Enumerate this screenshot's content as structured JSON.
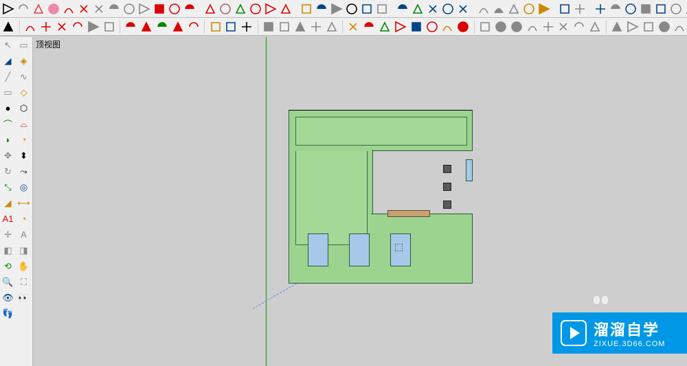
{
  "viewport_label": "顶视图",
  "watermark": {
    "title": "溜溜自学",
    "url": "ZIXUE.3D66.COM"
  },
  "toolbar_row1": [
    {
      "name": "select-arrow",
      "color": "#000"
    },
    {
      "name": "component-make",
      "color": "#888"
    },
    {
      "name": "paint-bucket",
      "color": "#d44"
    },
    {
      "name": "eraser",
      "color": "#e8a"
    },
    {
      "name": "pencil",
      "color": "#d00"
    },
    {
      "name": "freehand",
      "color": "#d00"
    },
    {
      "name": "rectangle",
      "color": "#888"
    },
    {
      "name": "rotated-rect",
      "color": "#888"
    },
    {
      "name": "circle",
      "color": "#888"
    },
    {
      "name": "polygon",
      "color": "#888"
    },
    {
      "name": "arc-2pt",
      "color": "#d00"
    },
    {
      "name": "arc-3pt",
      "color": "#d00"
    },
    {
      "name": "pie",
      "color": "#d00"
    },
    {
      "name": "sep"
    },
    {
      "name": "move",
      "color": "#d00"
    },
    {
      "name": "push-pull",
      "color": "#a66"
    },
    {
      "name": "rotate",
      "color": "#080"
    },
    {
      "name": "follow-me",
      "color": "#d00"
    },
    {
      "name": "scale",
      "color": "#d00"
    },
    {
      "name": "offset",
      "color": "#d00"
    },
    {
      "name": "sep"
    },
    {
      "name": "tape-measure",
      "color": "#c80"
    },
    {
      "name": "dimension",
      "color": "#048"
    },
    {
      "name": "protractor",
      "color": "#888"
    },
    {
      "name": "text-label",
      "color": "#000"
    },
    {
      "name": "axes",
      "color": "#048"
    },
    {
      "name": "3d-text",
      "color": "#888"
    },
    {
      "name": "sep"
    },
    {
      "name": "orbit-icon",
      "color": "#048"
    },
    {
      "name": "pan",
      "color": "#080"
    },
    {
      "name": "zoom",
      "color": "#048"
    },
    {
      "name": "zoom-window",
      "color": "#048"
    },
    {
      "name": "zoom-extents",
      "color": "#048"
    },
    {
      "name": "sep"
    },
    {
      "name": "position-camera",
      "color": "#888"
    },
    {
      "name": "look-around",
      "color": "#888"
    },
    {
      "name": "walk",
      "color": "#888"
    },
    {
      "name": "section-plane",
      "color": "#c80"
    },
    {
      "name": "section-display",
      "color": "#c80"
    },
    {
      "name": "sep"
    },
    {
      "name": "shadows",
      "color": "#048"
    },
    {
      "name": "fog",
      "color": "#888"
    },
    {
      "name": "sep"
    },
    {
      "name": "xray",
      "color": "#048"
    },
    {
      "name": "back-edges",
      "color": "#888"
    },
    {
      "name": "wireframe",
      "color": "#048"
    },
    {
      "name": "hidden-line",
      "color": "#888"
    },
    {
      "name": "shaded",
      "color": "#048"
    },
    {
      "name": "shaded-textures",
      "color": "#888"
    },
    {
      "name": "monochrome",
      "color": "#080"
    },
    {
      "name": "sep"
    },
    {
      "name": "model-info",
      "color": "#d00"
    },
    {
      "name": "entity-info",
      "color": "#080"
    },
    {
      "name": "materials",
      "color": "#048"
    },
    {
      "name": "components",
      "color": "#c80"
    },
    {
      "name": "styles",
      "color": "#888"
    },
    {
      "name": "layers",
      "color": "#048"
    },
    {
      "name": "outliner",
      "color": "#d00"
    },
    {
      "name": "scenes",
      "color": "#080"
    }
  ],
  "toolbar_row2": [
    {
      "name": "select-arrow-2",
      "color": "#000"
    },
    {
      "name": "sep"
    },
    {
      "name": "curve-1",
      "color": "#d00"
    },
    {
      "name": "curve-2",
      "color": "#d00"
    },
    {
      "name": "curve-3",
      "color": "#d00"
    },
    {
      "name": "curve-4",
      "color": "#d00"
    },
    {
      "name": "face-tool-1",
      "color": "#888"
    },
    {
      "name": "face-tool-2",
      "color": "#888"
    },
    {
      "name": "sep"
    },
    {
      "name": "move-2",
      "color": "#d00"
    },
    {
      "name": "push-2",
      "color": "#d00"
    },
    {
      "name": "rotate-2",
      "color": "#080"
    },
    {
      "name": "scale-2",
      "color": "#d00"
    },
    {
      "name": "offset-2",
      "color": "#d00"
    },
    {
      "name": "sep"
    },
    {
      "name": "tape-2",
      "color": "#c80"
    },
    {
      "name": "dim-2",
      "color": "#048"
    },
    {
      "name": "text-2",
      "color": "#000"
    },
    {
      "name": "sep"
    },
    {
      "name": "cam-iso",
      "color": "#888"
    },
    {
      "name": "cam-top",
      "color": "#888"
    },
    {
      "name": "cam-front",
      "color": "#888"
    },
    {
      "name": "cam-right",
      "color": "#888"
    },
    {
      "name": "cam-back",
      "color": "#888"
    },
    {
      "name": "sep"
    },
    {
      "name": "plugin-1",
      "color": "#c80"
    },
    {
      "name": "plugin-2",
      "color": "#d00"
    },
    {
      "name": "plugin-3",
      "color": "#080"
    },
    {
      "name": "plugin-4",
      "color": "#d00"
    },
    {
      "name": "plugin-5",
      "color": "#048"
    },
    {
      "name": "plugin-6",
      "color": "#d00"
    },
    {
      "name": "plugin-7",
      "color": "#c80"
    },
    {
      "name": "ruby",
      "color": "#d00"
    },
    {
      "name": "sep"
    },
    {
      "name": "warehouse-1",
      "color": "#888"
    },
    {
      "name": "warehouse-2",
      "color": "#888"
    },
    {
      "name": "house-1",
      "color": "#888"
    },
    {
      "name": "house-2",
      "color": "#888"
    },
    {
      "name": "house-3",
      "color": "#888"
    },
    {
      "name": "house-4",
      "color": "#888"
    },
    {
      "name": "house-5",
      "color": "#888"
    },
    {
      "name": "house-6",
      "color": "#888"
    },
    {
      "name": "sep"
    },
    {
      "name": "box-1",
      "color": "#888"
    },
    {
      "name": "box-2",
      "color": "#888"
    },
    {
      "name": "box-3",
      "color": "#888"
    },
    {
      "name": "box-4",
      "color": "#888"
    },
    {
      "name": "box-5",
      "color": "#888"
    }
  ],
  "toolbar_left": [
    {
      "name": "select",
      "glyph": "↖"
    },
    {
      "name": "make-component",
      "glyph": "▭"
    },
    {
      "name": "paint-bucket-l",
      "glyph": "◢"
    },
    {
      "name": "eraser-l",
      "glyph": "◈"
    },
    {
      "name": "line",
      "glyph": "╱"
    },
    {
      "name": "freehand-l",
      "glyph": "∿"
    },
    {
      "name": "rectangle-l",
      "glyph": "▭"
    },
    {
      "name": "rotated-rect-l",
      "glyph": "◇"
    },
    {
      "name": "circle-l",
      "glyph": "●"
    },
    {
      "name": "polygon-l",
      "glyph": "⬡"
    },
    {
      "name": "arc-l",
      "glyph": "⌒"
    },
    {
      "name": "arc-2pt-l",
      "glyph": "⌓"
    },
    {
      "name": "arc-3pt-l",
      "glyph": "◗"
    },
    {
      "name": "pie-l",
      "glyph": "◔"
    },
    {
      "name": "move-l",
      "glyph": "✥"
    },
    {
      "name": "push-pull-l",
      "glyph": "⬍"
    },
    {
      "name": "rotate-l",
      "glyph": "↻"
    },
    {
      "name": "follow-me-l",
      "glyph": "⤳"
    },
    {
      "name": "scale-l",
      "glyph": "⤡"
    },
    {
      "name": "offset-l",
      "glyph": "◎"
    },
    {
      "name": "tape-l",
      "glyph": "◢"
    },
    {
      "name": "dimension-l",
      "glyph": "⟷"
    },
    {
      "name": "text-l",
      "glyph": "A1"
    },
    {
      "name": "protractor-l",
      "glyph": "◔"
    },
    {
      "name": "axes-l",
      "glyph": "✛"
    },
    {
      "name": "3d-text-l",
      "glyph": "A"
    },
    {
      "name": "section-l",
      "glyph": "◧"
    },
    {
      "name": "section-fill-l",
      "glyph": "◨"
    },
    {
      "name": "orbit-l",
      "glyph": "⟲"
    },
    {
      "name": "pan-l",
      "glyph": "✋"
    },
    {
      "name": "zoom-l",
      "glyph": "🔍"
    },
    {
      "name": "zoom-ext-l",
      "glyph": "⛶"
    },
    {
      "name": "position-cam-l",
      "glyph": "👁"
    },
    {
      "name": "look-l",
      "glyph": "👀"
    },
    {
      "name": "walk-l",
      "glyph": "👣"
    },
    {
      "name": "blank-l",
      "glyph": ""
    }
  ]
}
